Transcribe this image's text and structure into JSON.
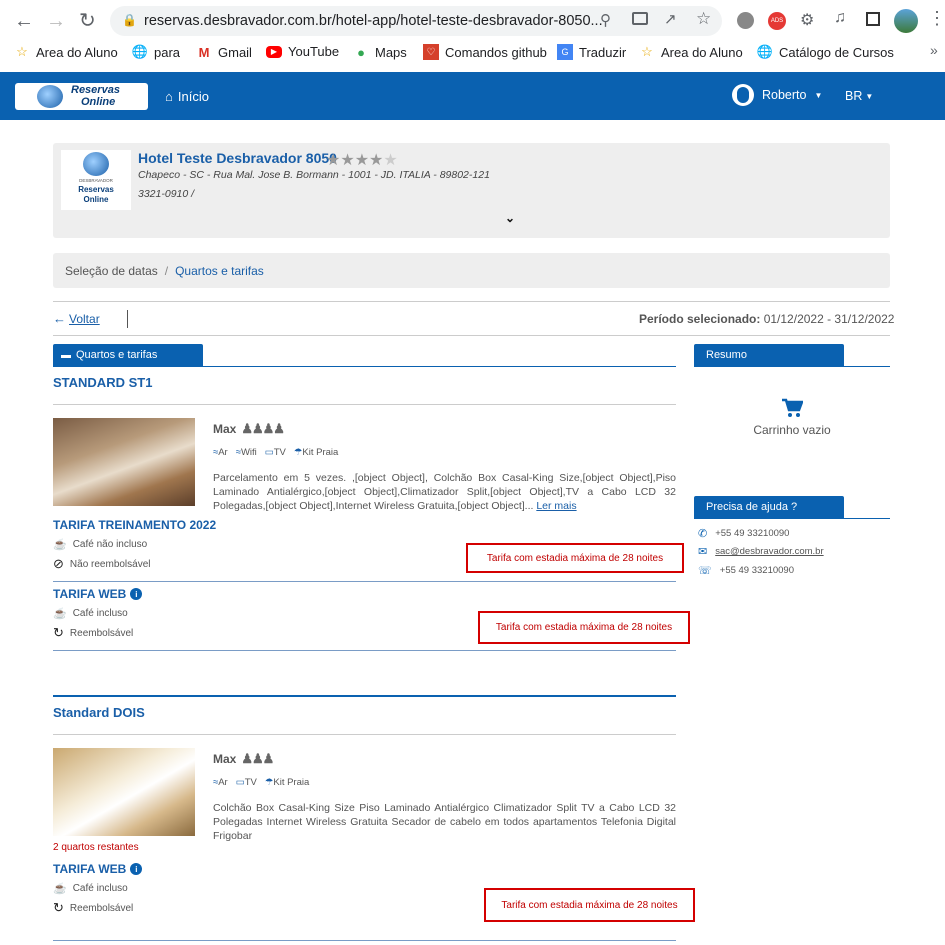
{
  "browser": {
    "url": "reservas.desbravador.com.br/hotel-app/hotel-teste-desbravador-8050...",
    "bookmarks": [
      "Area do Aluno",
      "para",
      "Gmail",
      "YouTube",
      "Maps",
      "Comandos github",
      "Traduzir",
      "Area do Aluno",
      "Catálogo de Cursos"
    ]
  },
  "header": {
    "logo_line1": "Reservas",
    "logo_line2": "Online",
    "home_label": "Início",
    "user_label": "Roberto",
    "lang_label": "BR"
  },
  "hotel": {
    "name": "Hotel Teste Desbravador 8050",
    "stars_filled": 4,
    "stars_total": 5,
    "address": "Chapeco - SC - Rua Mal. Jose B. Bormann - 1001 - JD. ITALIA - 89802-121",
    "phone": "3321-0910 /",
    "logo_top": "DESBRAVADOR",
    "logo_l1": "Reservas",
    "logo_l2": "Online"
  },
  "breadcrumb": {
    "step1": "Seleção de datas",
    "sep": "/",
    "step2": "Quartos e tarifas"
  },
  "toolbar": {
    "back_label": "Voltar",
    "period_label": "Período selecionado:",
    "period_value": "01/12/2022 - 31/12/2022"
  },
  "tabs": {
    "rooms": "Quartos e tarifas",
    "summary": "Resumo",
    "help": "Precisa de ajuda ?"
  },
  "summary": {
    "cart_empty": "Carrinho vazio"
  },
  "help": {
    "phone": "+55 49 33210090",
    "email": "sac@desbravador.com.br",
    "whatsapp": "+55 49 33210090"
  },
  "rooms": [
    {
      "title": "STANDARD ST1",
      "max_label": "Max",
      "max_people": 4,
      "amenities": [
        "Ar",
        "Wifi",
        "TV",
        "Kit Praia"
      ],
      "description": "Parcelamento em 5 vezes. ,[object Object], Colchão Box Casal-King Size,[object Object],Piso Laminado Antialérgico,[object Object],Climatizador Split,[object Object],TV a Cabo LCD 32 Polegadas,[object Object],Internet Wireless Gratuita,[object Object]...",
      "more_label": "Ler mais",
      "rates": [
        {
          "name": "TARIFA TREINAMENTO 2022",
          "breakfast": "Café não incluso",
          "refund": "Não reembolsável",
          "warning": "Tarifa com estadia máxima de 28 noites"
        },
        {
          "name": "TARIFA WEB",
          "breakfast": "Café incluso",
          "refund": "Reembolsável",
          "warning": "Tarifa com estadia máxima de 28 noites"
        }
      ]
    },
    {
      "title": "Standard DOIS",
      "max_label": "Max",
      "max_people": 3,
      "amenities": [
        "Ar",
        "TV",
        "Kit Praia"
      ],
      "description": "Colchão Box Casal-King Size Piso Laminado Antialérgico Climatizador Split TV a Cabo LCD 32 Polegadas Internet Wireless Gratuita Secador de cabelo em todos apartamentos Telefonia Digital Frigobar",
      "remaining": "2 quartos restantes",
      "rates": [
        {
          "name": "TARIFA WEB",
          "breakfast": "Café incluso",
          "refund": "Reembolsável",
          "warning": "Tarifa com estadia máxima de 28 noites"
        }
      ]
    }
  ],
  "colors": {
    "primary": "#0a61b0",
    "link": "#1a5fa8",
    "warning": "#d40000"
  }
}
